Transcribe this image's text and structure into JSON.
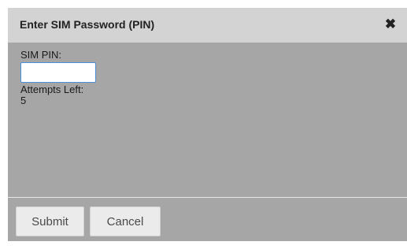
{
  "dialog": {
    "title": "Enter SIM Password (PIN)",
    "close_glyph": "✖",
    "close_icon": "close-icon"
  },
  "form": {
    "pin_label": "SIM PIN:",
    "pin_value": "",
    "attempts_label": "Attempts Left:",
    "attempts_value": "5"
  },
  "buttons": {
    "submit_label": "Submit",
    "cancel_label": "Cancel"
  },
  "colors": {
    "titlebar": "#d3d3d3",
    "body_bg": "#a6a6a6",
    "input_focus_border": "#4a90d9",
    "button_bg": "#ebebeb"
  }
}
